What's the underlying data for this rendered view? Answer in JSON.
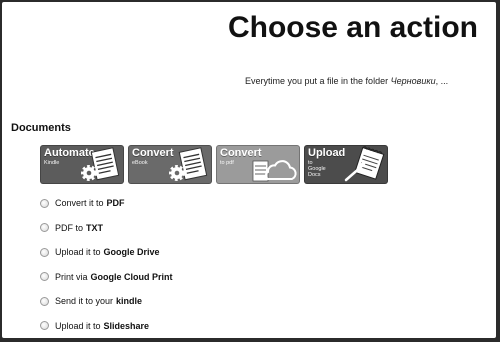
{
  "page": {
    "title": "Choose an action"
  },
  "intro": {
    "prefix": "Everytime you put a file in the folder",
    "folder": "Черновики",
    "suffix": ", ..."
  },
  "section": {
    "title": "Documents"
  },
  "tiles": [
    {
      "title": "Automate",
      "subtitle": "Kindle",
      "color": "#5c5c5c",
      "icon": "document-gear-icon"
    },
    {
      "title": "Convert",
      "subtitle": "eBook",
      "color": "#6a6a6a",
      "icon": "document-gear-icon"
    },
    {
      "title": "Convert",
      "subtitle": "to pdf",
      "color": "#9b9b9b",
      "icon": "document-cloud-icon"
    },
    {
      "title": "Upload",
      "subtitle": "to Google Docs",
      "color": "#4c4c4c",
      "icon": "notepad-pen-icon"
    }
  ],
  "actions": [
    {
      "prefix": "Convert it to",
      "bold": "PDF"
    },
    {
      "prefix": "PDF to",
      "bold": "TXT"
    },
    {
      "prefix": "Upload it to",
      "bold": "Google Drive"
    },
    {
      "prefix": "Print via",
      "bold": "Google Cloud Print"
    },
    {
      "prefix": "Send it to your",
      "bold": "kindle"
    },
    {
      "prefix": "Upload it to",
      "bold": "Slideshare"
    }
  ]
}
